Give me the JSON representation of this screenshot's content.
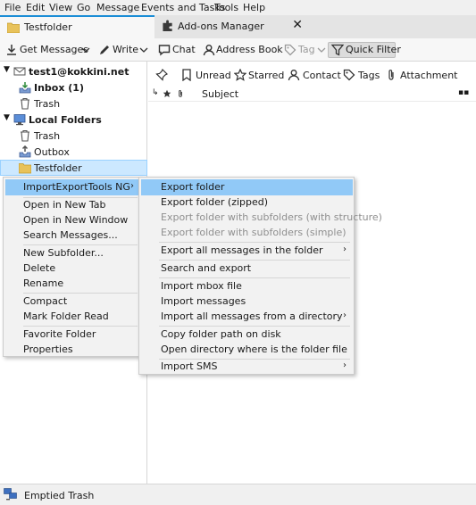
{
  "menubar": {
    "items": [
      "File",
      "Edit",
      "View",
      "Go",
      "Message",
      "Events and Tasks",
      "Tools",
      "Help"
    ]
  },
  "tabs": [
    {
      "label": "Testfolder"
    },
    {
      "label": "Add-ons Manager",
      "close": "✕"
    }
  ],
  "toolbar": {
    "get_messages": "Get Messages",
    "write": "Write",
    "chat": "Chat",
    "address_book": "Address Book",
    "tag": "Tag",
    "quick_filter": "Quick Filter"
  },
  "folders": {
    "account": "test1@kokkini.net",
    "inbox": "Inbox (1)",
    "trash1": "Trash",
    "local_folders": "Local Folders",
    "trash2": "Trash",
    "outbox": "Outbox",
    "testfolder": "Testfolder"
  },
  "quickfilter": {
    "unread": "Unread",
    "starred": "Starred",
    "contact": "Contact",
    "tags": "Tags",
    "attachment": "Attachment"
  },
  "thread": {
    "subject_col": "Subject"
  },
  "context_menu": {
    "items": [
      "ImportExportTools NG",
      "Open in New Tab",
      "Open in New Window",
      "Search Messages...",
      "New Subfolder...",
      "Delete",
      "Rename",
      "Compact",
      "Mark Folder Read",
      "Favorite Folder",
      "Properties"
    ]
  },
  "submenu": {
    "items": [
      "Export folder",
      "Export folder (zipped)",
      "Export folder with subfolders (with structure)",
      "Export folder with subfolders (simple)",
      "Export all messages in the folder",
      "Search and export",
      "Import mbox file",
      "Import messages",
      "Import all messages from a directory",
      "Copy folder path on disk",
      "Open directory where is the folder file",
      "Import SMS"
    ]
  },
  "status": {
    "text": "Emptied Trash"
  },
  "colors": {
    "accent": "#1b8dd6",
    "highlight": "#91c9f7",
    "selection": "#cce8ff"
  }
}
